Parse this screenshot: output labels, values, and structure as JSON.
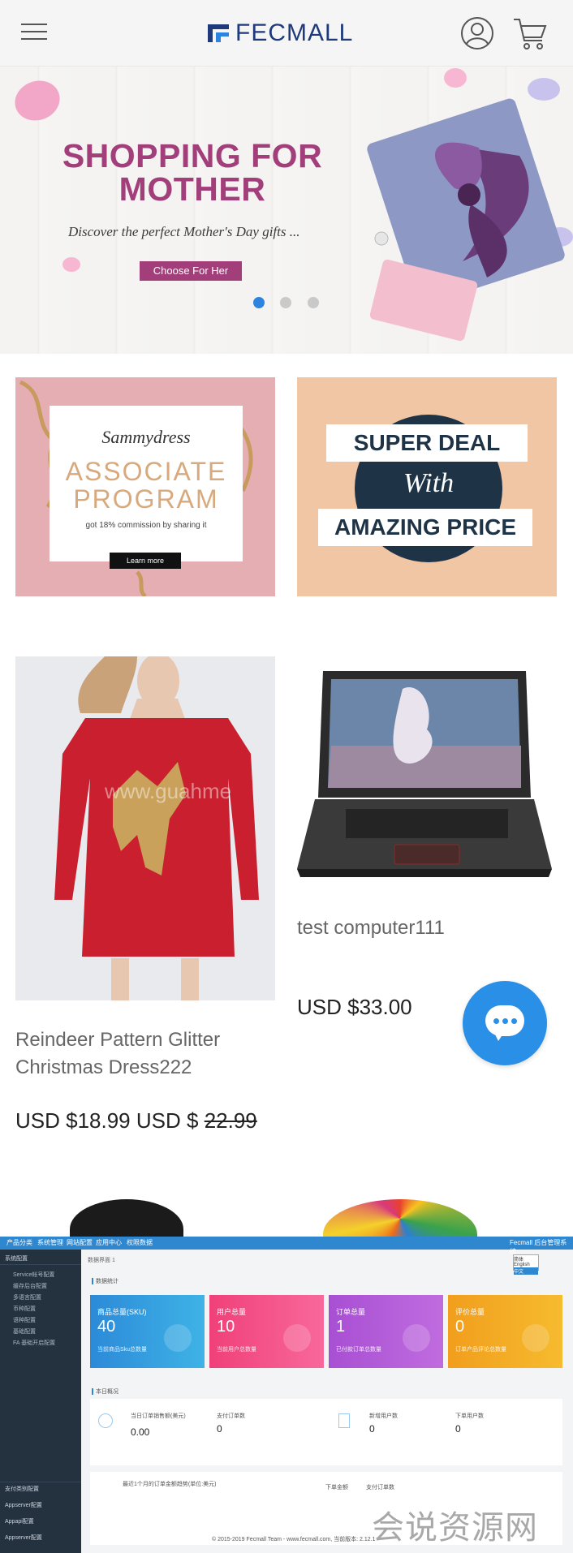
{
  "header": {
    "logo_text": "FECMALL",
    "menu_icon": "hamburger-menu-icon",
    "user_icon": "user-account-icon",
    "cart_icon": "shopping-cart-icon"
  },
  "hero": {
    "title_line1": "SHOPPING FOR",
    "title_line2": "MOTHER",
    "subtitle": "Discover the perfect Mother's Day gifts ...",
    "button": "Choose For Her",
    "slides": 3,
    "active_slide": 1,
    "colors": {
      "title": "#a23e7a",
      "active_dot": "#2d84e0"
    }
  },
  "promos": [
    {
      "brand": "Sammydress",
      "line1": "ASSOCIATE",
      "line2": "PROGRAM",
      "text": "got 18% commission by sharing it",
      "button": "Learn more"
    },
    {
      "line1": "SUPER DEAL",
      "line2": "With",
      "line3": "AMAZING PRICE"
    }
  ],
  "products": [
    {
      "name": "Reindeer Pattern Glitter Christmas Dress222",
      "price": "USD $18.99",
      "old_price_prefix": "USD $",
      "old_price": "22.99",
      "watermark": "www.guahme"
    },
    {
      "name": "test computer111",
      "price": "USD $33.00"
    }
  ],
  "chat": {
    "icon": "chat-bubble-icon",
    "color": "#2a8fe6"
  },
  "admin": {
    "top_nav": [
      "产品分类",
      "系统管理",
      "网站配置",
      "应用中心",
      "权限数据"
    ],
    "top_right": "Fecmall 后台管理系统",
    "breadcrumb": "数据界面 1",
    "lang_options": [
      "简体",
      "English",
      "中文"
    ],
    "side_group_top": "系统配置",
    "side_items": [
      "Service帐号配置",
      "缓存后台配置",
      "多语言配置",
      "币种配置",
      "语种配置",
      "基础配置",
      "FA 基础开启配置"
    ],
    "side_groups_bottom": [
      "支付类别配置",
      "Appserver配置",
      "Appapi配置",
      "Appserver配置"
    ],
    "section1": "数据统计",
    "stats": [
      {
        "label": "商品总量(SKU)",
        "value": "40",
        "desc": "当前商品Sku总数量"
      },
      {
        "label": "用户总量",
        "value": "10",
        "desc": "当前用户总数量"
      },
      {
        "label": "订单总量",
        "value": "1",
        "desc": "已付款订单总数量"
      },
      {
        "label": "评价总量",
        "value": "0",
        "desc": "订单产品评论总数量"
      }
    ],
    "section2": "本日概况",
    "today": [
      {
        "label": "当日订单销售额(美元)",
        "value": "0.00"
      },
      {
        "label": "支付订单数",
        "value": "0"
      },
      {
        "label": "新增用户数",
        "value": "0"
      },
      {
        "label": "下单用户数",
        "value": "0"
      }
    ],
    "chart_title": "最近1个月的订单金额趋势(单位:美元)",
    "chart_legend": [
      "下单金额",
      "支付订单数"
    ],
    "footer": "© 2015-2019 Fecmall Team - www.fecmall.com, 当前版本: 2.12.1"
  },
  "watermark": "会说资源网"
}
